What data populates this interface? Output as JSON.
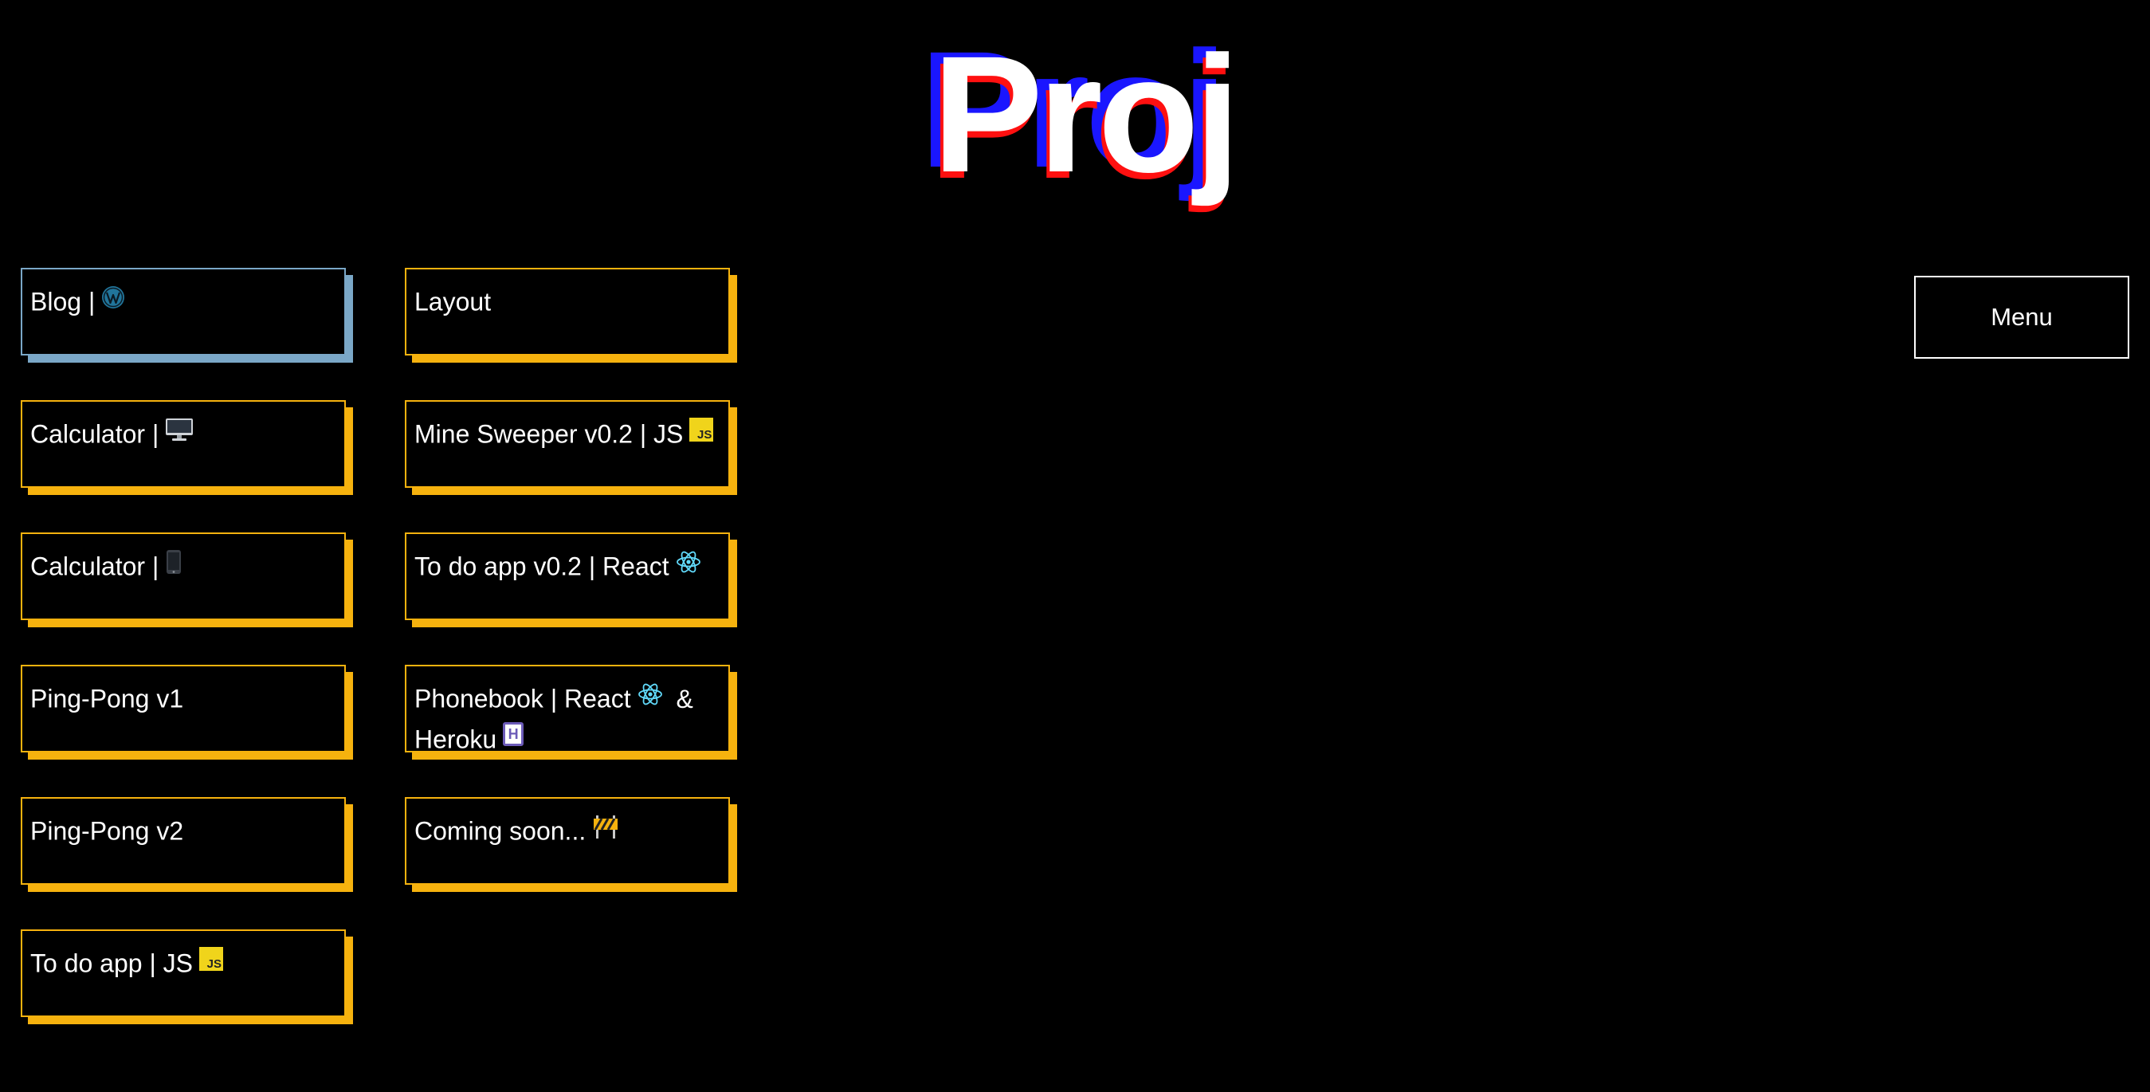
{
  "header": {
    "title": "Proj"
  },
  "menu": {
    "label": "Menu"
  },
  "projects": {
    "col1": [
      {
        "label": "Blog |",
        "icon": "wordpress-icon"
      },
      {
        "label": "Calculator |",
        "icon": "desktop-computer-icon"
      },
      {
        "label": "Calculator |",
        "icon": "mobile-phone-icon"
      },
      {
        "label": "Ping-Pong v1"
      },
      {
        "label": "Ping-Pong v2"
      },
      {
        "label": "To do app | JS",
        "icon": "javascript-icon"
      }
    ],
    "col2": [
      {
        "label": "Layout"
      },
      {
        "label": "Mine Sweeper v0.2 | JS",
        "icon": "javascript-icon"
      },
      {
        "label": "To do app v0.2 | React",
        "icon": "react-icon"
      },
      {
        "label_part1": "Phonebook | React",
        "label_part2": "&",
        "label_part3": "Heroku",
        "icons": [
          "react-icon",
          "heroku-icon"
        ]
      },
      {
        "label": "Coming soon...",
        "icon": "construction-barrier-icon"
      }
    ]
  },
  "icons": {
    "js_text": "JS",
    "heroku_text": "H"
  },
  "colors": {
    "background": "#000000",
    "card_border": "#f6b20e",
    "blog_border": "#7aa7c7",
    "title_blue": "#1a16ff",
    "title_red": "#ff1010",
    "react": "#61dafb"
  }
}
